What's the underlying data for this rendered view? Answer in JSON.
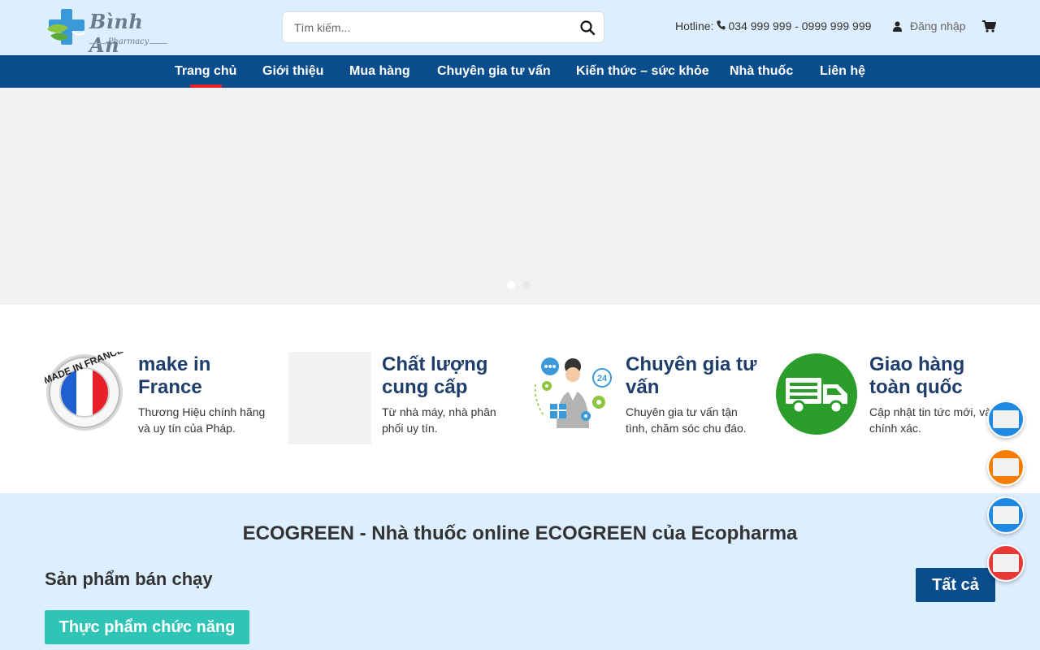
{
  "header": {
    "logo": {
      "name": "Bình An",
      "subtitle": "Pharmacy"
    },
    "search": {
      "placeholder": "Tìm kiếm..."
    },
    "hotline": {
      "label": "Hotline:",
      "numbers": "034 999 999 - 0999 999 999"
    },
    "login_label": "Đăng nhập",
    "icons": [
      "search-icon",
      "phone-icon",
      "user-icon",
      "cart-icon"
    ]
  },
  "nav": {
    "items": [
      {
        "label": "Trang chủ",
        "active": true
      },
      {
        "label": "Giới thiệu"
      },
      {
        "label": "Mua hàng"
      },
      {
        "label": "Chuyên gia tư vấn"
      },
      {
        "label": "Kiến thức – sức khỏe"
      },
      {
        "label": "Nhà thuốc"
      },
      {
        "label": "Liên hệ"
      }
    ]
  },
  "banner": {
    "slides": 2,
    "active_slide": 1
  },
  "features": [
    {
      "title": "make in France",
      "desc": "Thương Hiệu chính hãng và uy tín của Pháp.",
      "badge_text": "MADE IN FRANCE"
    },
    {
      "title": "Chất lượng cung cấp",
      "desc": "Từ nhà máy, nhà phân phối uy tín."
    },
    {
      "title": "Chuyên gia tư vấn",
      "desc": "Chuyên gia tư vấn tận tình, chăm sóc chu đáo."
    },
    {
      "title": "Giao hàng toàn quốc",
      "desc": "Cập nhật tin tức mới, và chính xác."
    }
  ],
  "section": {
    "title": "ECOGREEN - Nhà thuốc online ECOGREEN của Ecopharma",
    "best_sellers": "Sản phẩm bán chạy",
    "all_button": "Tất cả",
    "category_button": "Thực phẩm chức năng"
  },
  "float_buttons": [
    {
      "color": "#1e88e5"
    },
    {
      "color": "#f57c00"
    },
    {
      "color": "#1e88e5"
    },
    {
      "color": "#e53935"
    }
  ],
  "colors": {
    "header_bg": "#ddeeff",
    "nav_bg": "#0a4d8c",
    "nav_active": "#e8202a",
    "feature_title": "#1f3e6b",
    "category_button": "#2ec4b6",
    "delivery_green": "#2a9d2a"
  }
}
